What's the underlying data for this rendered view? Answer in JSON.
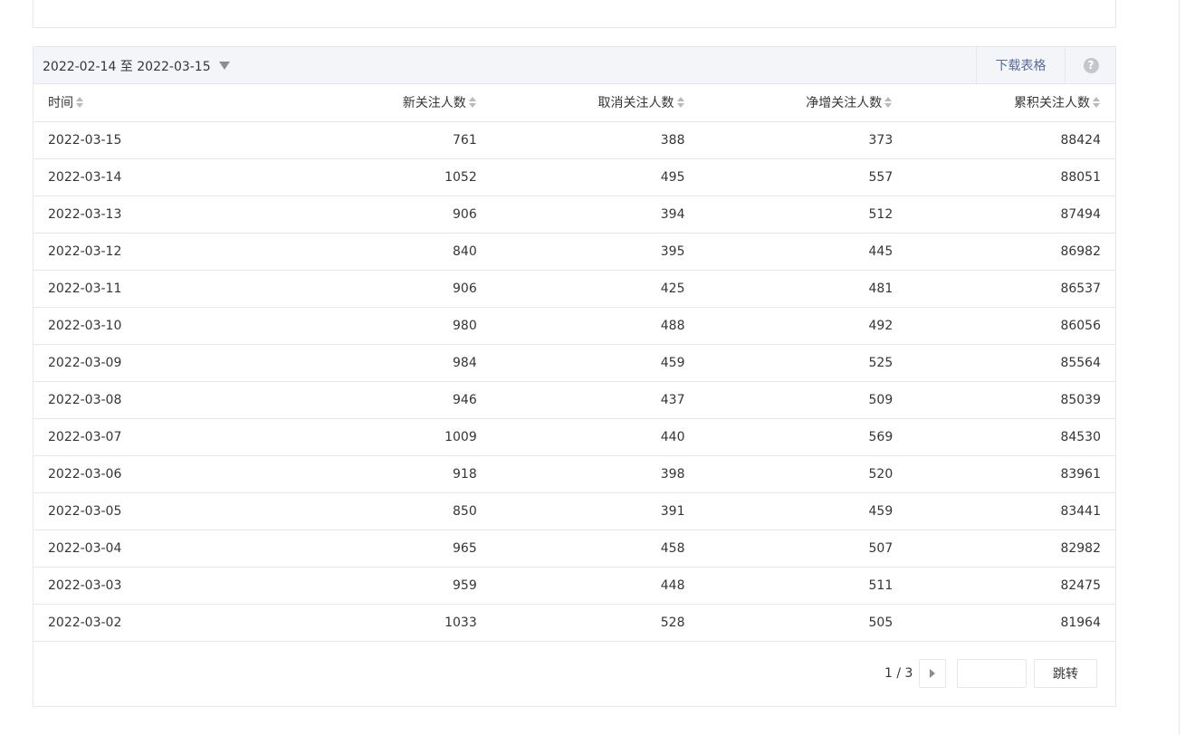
{
  "toolbar": {
    "date_range": "2022-02-14 至 2022-03-15",
    "download_label": "下载表格",
    "help_icon": "question-circle-icon",
    "help_glyph": "?"
  },
  "table": {
    "headers": [
      "时间",
      "新关注人数",
      "取消关注人数",
      "净增关注人数",
      "累积关注人数"
    ],
    "rows": [
      [
        "2022-03-15",
        "761",
        "388",
        "373",
        "88424"
      ],
      [
        "2022-03-14",
        "1052",
        "495",
        "557",
        "88051"
      ],
      [
        "2022-03-13",
        "906",
        "394",
        "512",
        "87494"
      ],
      [
        "2022-03-12",
        "840",
        "395",
        "445",
        "86982"
      ],
      [
        "2022-03-11",
        "906",
        "425",
        "481",
        "86537"
      ],
      [
        "2022-03-10",
        "980",
        "488",
        "492",
        "86056"
      ],
      [
        "2022-03-09",
        "984",
        "459",
        "525",
        "85564"
      ],
      [
        "2022-03-08",
        "946",
        "437",
        "509",
        "85039"
      ],
      [
        "2022-03-07",
        "1009",
        "440",
        "569",
        "84530"
      ],
      [
        "2022-03-06",
        "918",
        "398",
        "520",
        "83961"
      ],
      [
        "2022-03-05",
        "850",
        "391",
        "459",
        "83441"
      ],
      [
        "2022-03-04",
        "965",
        "458",
        "507",
        "82982"
      ],
      [
        "2022-03-03",
        "959",
        "448",
        "511",
        "82475"
      ],
      [
        "2022-03-02",
        "1033",
        "528",
        "505",
        "81964"
      ]
    ]
  },
  "pagination": {
    "page_info": "1 / 3",
    "jump_label": "跳转",
    "page_input_value": ""
  },
  "colors": {
    "link": "#576b95",
    "header_bg": "#f4f5f9",
    "border": "#e7e7eb"
  }
}
